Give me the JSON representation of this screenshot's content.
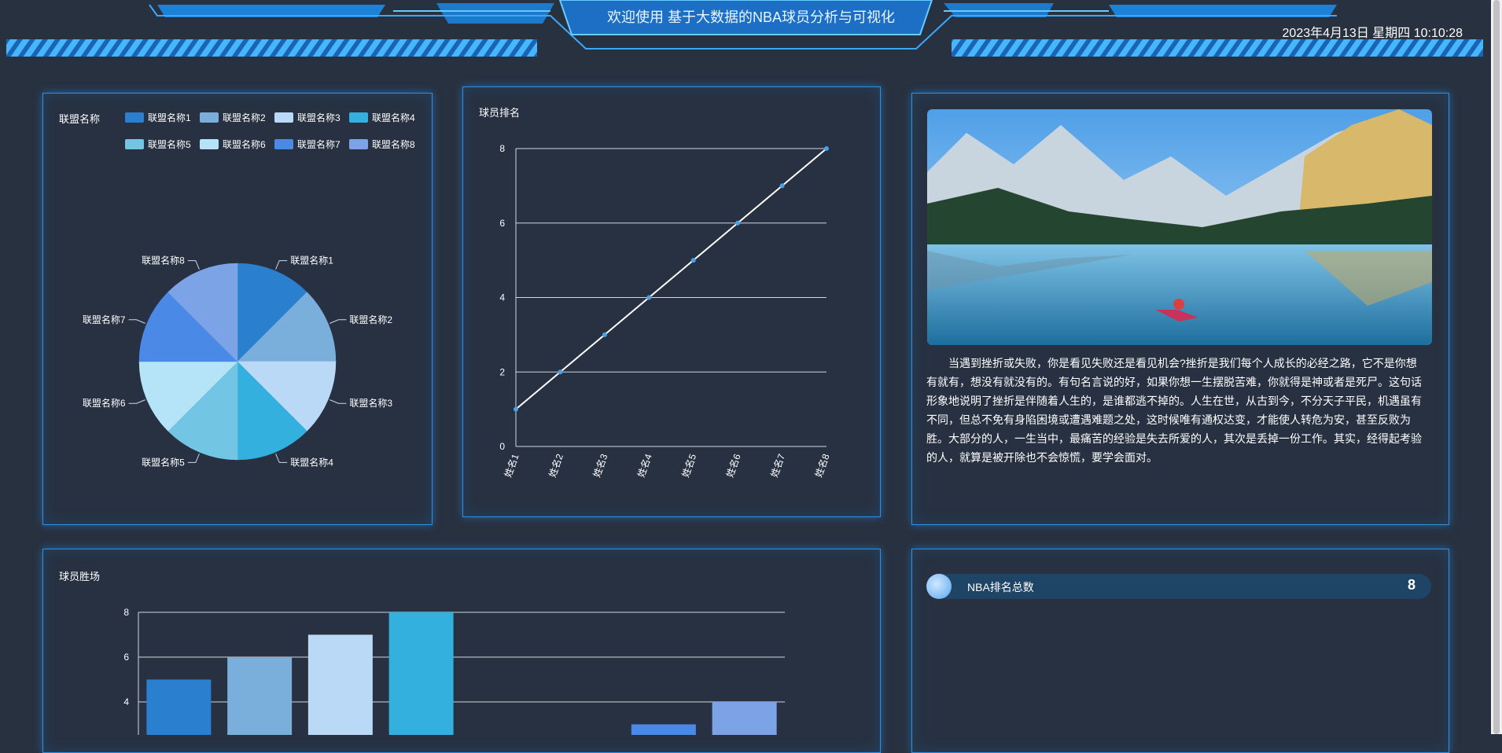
{
  "header": {
    "title": "欢迎使用 基于大数据的NBA球员分析与可视化",
    "datetime": "2023年4月13日 星期四 10:10:28"
  },
  "colors": {
    "background": "#28313f",
    "accent": "#2f8fe0",
    "series": [
      "#2b7fcf",
      "#7aaedb",
      "#b9d9f7",
      "#33b0de",
      "#72c6e4",
      "#b5e3f7",
      "#4a8ae6",
      "#7ca3e6"
    ]
  },
  "pie_panel": {
    "title": "联盟名称"
  },
  "line_panel": {
    "title": "球员排名"
  },
  "bar_panel": {
    "title": "球员胜场"
  },
  "article": {
    "text": "当遇到挫折或失败，你是看见失败还是看见机会?挫折是我们每个人成长的必经之路，它不是你想有就有，想没有就没有的。有句名言说的好，如果你想一生摆脱苦难，你就得是神或者是死尸。这句话形象地说明了挫折是伴随着人生的，是谁都逃不掉的。人生在世，从古到今，不分天子平民，机遇虽有不同，但总不免有身陷困境或遭遇难题之处，这时候唯有通权达变，才能使人转危为安，甚至反败为胜。大部分的人，一生当中，最痛苦的经验是失去所爱的人，其次是丢掉一份工作。其实，经得起考验的人，就算是被开除也不会惊慌，要学会面对。"
  },
  "stat": {
    "label": "NBA排名总数",
    "value": "8"
  },
  "chart_data": [
    {
      "type": "pie",
      "title": "联盟名称",
      "categories": [
        "联盟名称1",
        "联盟名称2",
        "联盟名称3",
        "联盟名称4",
        "联盟名称5",
        "联盟名称6",
        "联盟名称7",
        "联盟名称8"
      ],
      "values": [
        1,
        1,
        1,
        1,
        1,
        1,
        1,
        1
      ],
      "legend": "top"
    },
    {
      "type": "line",
      "title": "球员排名",
      "categories": [
        "姓名1",
        "姓名2",
        "姓名3",
        "姓名4",
        "姓名5",
        "姓名6",
        "姓名7",
        "姓名8"
      ],
      "values": [
        1,
        2,
        3,
        4,
        5,
        6,
        7,
        8
      ],
      "ylim": [
        0,
        8
      ],
      "yticks": [
        0,
        2,
        4,
        6,
        8
      ],
      "grid": true
    },
    {
      "type": "bar",
      "title": "球员胜场",
      "categories": [
        "",
        "",
        "",
        "",
        "",
        "",
        "",
        ""
      ],
      "values": [
        5,
        6,
        7,
        8,
        null,
        null,
        3,
        4
      ],
      "ylim": [
        0,
        8
      ],
      "yticks": [
        4,
        6,
        8
      ],
      "grid": true
    }
  ]
}
